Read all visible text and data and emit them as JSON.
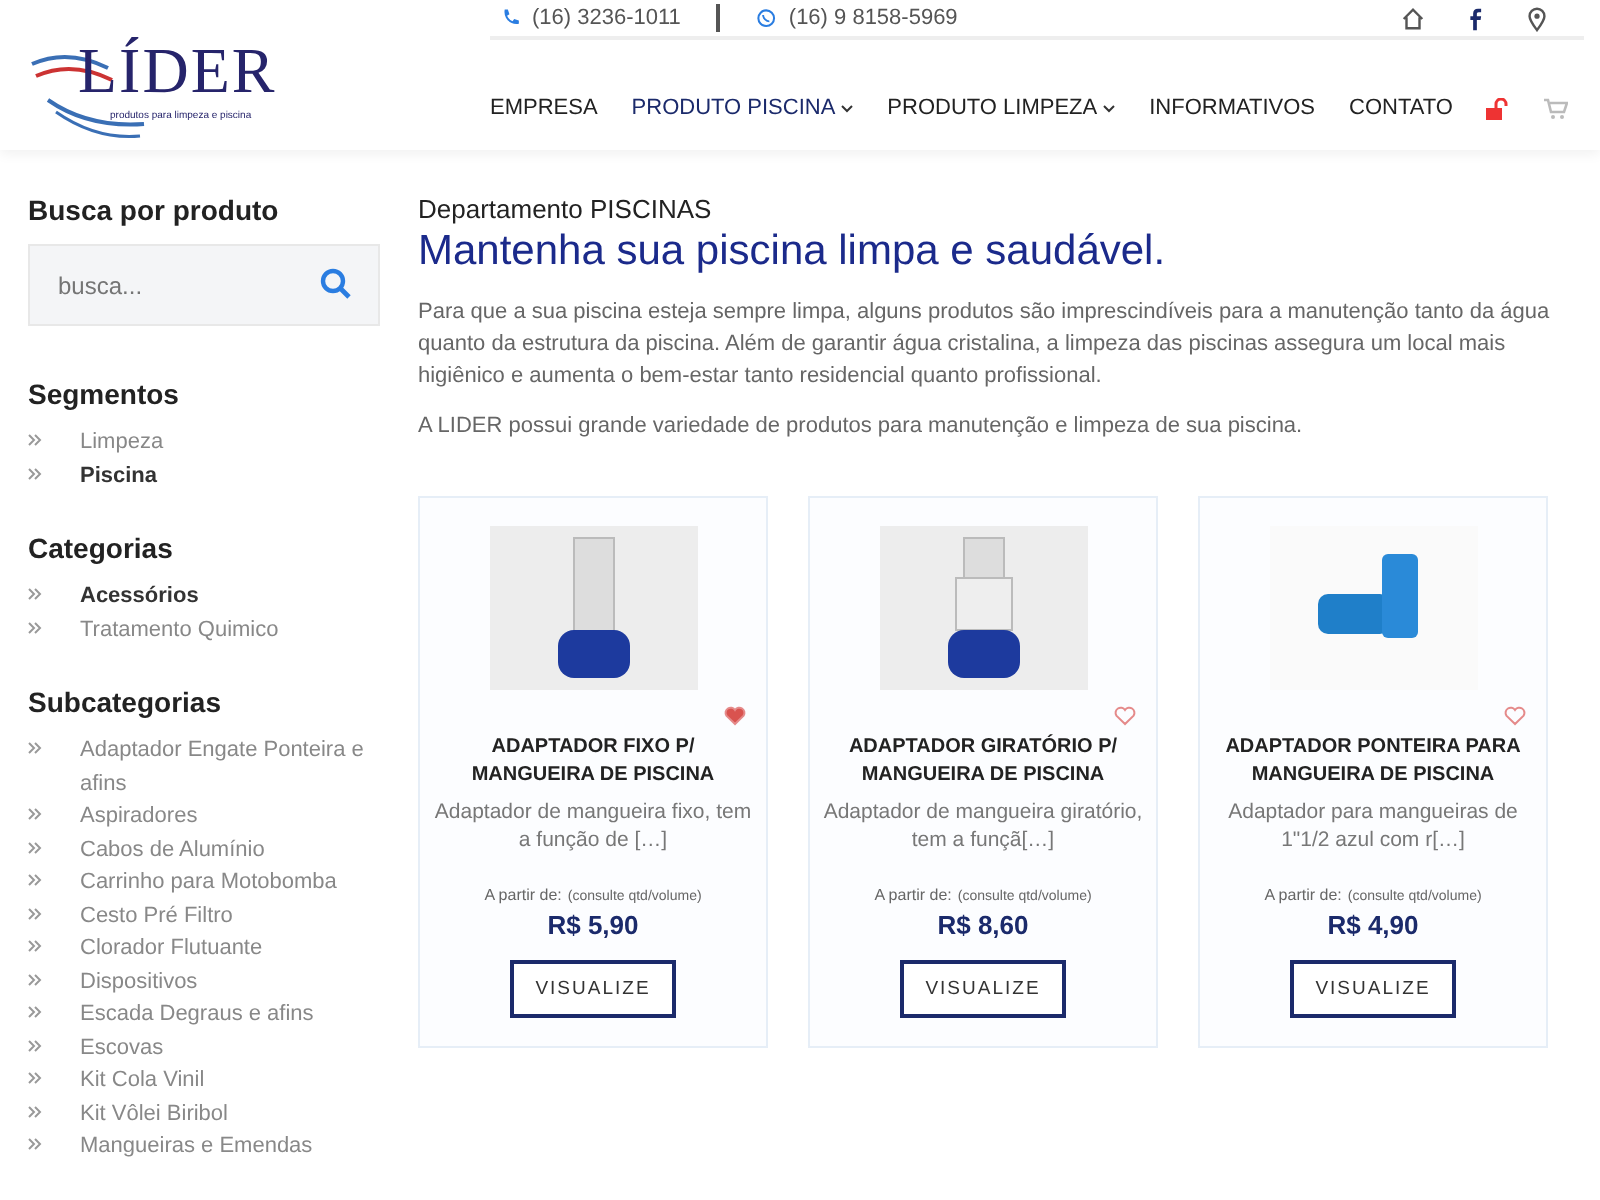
{
  "header": {
    "logo": {
      "name": "LÍDER",
      "tagline": "produtos para limpeza e piscina"
    },
    "contacts": [
      {
        "kind": "phone",
        "text": "(16) 3236-1011"
      },
      {
        "kind": "whatsapp",
        "text": "(16) 9 8158-5969"
      }
    ],
    "social": [
      {
        "kind": "home"
      },
      {
        "kind": "facebook"
      },
      {
        "kind": "location"
      }
    ],
    "nav": [
      {
        "label": "EMPRESA",
        "dropdown": false,
        "selected": false
      },
      {
        "label": "PRODUTO PISCINA",
        "dropdown": true,
        "selected": true
      },
      {
        "label": "PRODUTO LIMPEZA",
        "dropdown": true,
        "selected": false
      },
      {
        "label": "INFORMATIVOS",
        "dropdown": false,
        "selected": false
      },
      {
        "label": "CONTATO",
        "dropdown": false,
        "selected": false
      }
    ]
  },
  "sidebar": {
    "search": {
      "title": "Busca por produto",
      "placeholder": "busca..."
    },
    "sections": [
      {
        "title": "Segmentos",
        "items": [
          {
            "label": "Limpeza",
            "selected": false
          },
          {
            "label": "Piscina",
            "selected": true
          }
        ]
      },
      {
        "title": "Categorias",
        "items": [
          {
            "label": "Acessórios",
            "selected": true
          },
          {
            "label": "Tratamento Quimico",
            "selected": false
          }
        ]
      },
      {
        "title": "Subcategorias",
        "items": [
          {
            "label": "Adaptador Engate Ponteira e afins",
            "selected": false
          },
          {
            "label": "Aspiradores",
            "selected": false
          },
          {
            "label": "Cabos de Alumínio",
            "selected": false
          },
          {
            "label": "Carrinho para Motobomba",
            "selected": false
          },
          {
            "label": "Cesto Pré Filtro",
            "selected": false
          },
          {
            "label": "Clorador Flutuante",
            "selected": false
          },
          {
            "label": "Dispositivos",
            "selected": false
          },
          {
            "label": "Escada Degraus e afins",
            "selected": false
          },
          {
            "label": "Escovas",
            "selected": false
          },
          {
            "label": "Kit Cola Vinil",
            "selected": false
          },
          {
            "label": "Kit Vôlei Biribol",
            "selected": false
          },
          {
            "label": "Mangueiras e Emendas",
            "selected": false
          }
        ]
      }
    ]
  },
  "main": {
    "department": "Departamento PISCINAS",
    "heading": "Mantenha sua piscina limpa e saudável.",
    "paragraphs": [
      "Para que a sua piscina esteja sempre limpa, alguns produtos são imprescindíveis para a manutenção tanto da água quanto da estrutura da piscina. Além de garantir água cristalina, a limpeza das piscinas assegura um local mais higiênico e aumenta o bem-estar tanto residencial quanto profissional.",
      "A LIDER possui grande variedade de produtos para manutenção e limpeza de sua piscina."
    ],
    "products": [
      {
        "kind": "fixed",
        "favorite": true,
        "title": "ADAPTADOR FIXO P/ MANGUEIRA DE PISCINA",
        "description": "Adaptador de mangueira fixo, tem a função de […]",
        "price_label": "A partir de:",
        "price_note": "(consulte qtd/volume)",
        "price": "R$ 5,90",
        "button": "VISUALIZE"
      },
      {
        "kind": "swivel",
        "favorite": false,
        "title": "ADAPTADOR GIRATÓRIO P/ MANGUEIRA DE PISCINA",
        "description": "Adaptador de mangueira giratório, tem a funçã[…]",
        "price_label": "A partir de:",
        "price_note": "(consulte qtd/volume)",
        "price": "R$ 8,60",
        "button": "VISUALIZE"
      },
      {
        "kind": "nozzle",
        "favorite": false,
        "title": "ADAPTADOR PONTEIRA PARA MANGUEIRA DE PISCINA",
        "description": "Adaptador para mangueiras de 1\"1/2 azul com r[…]",
        "price_label": "A partir de:",
        "price_note": "(consulte qtd/volume)",
        "price": "R$ 4,90",
        "button": "VISUALIZE"
      }
    ]
  }
}
